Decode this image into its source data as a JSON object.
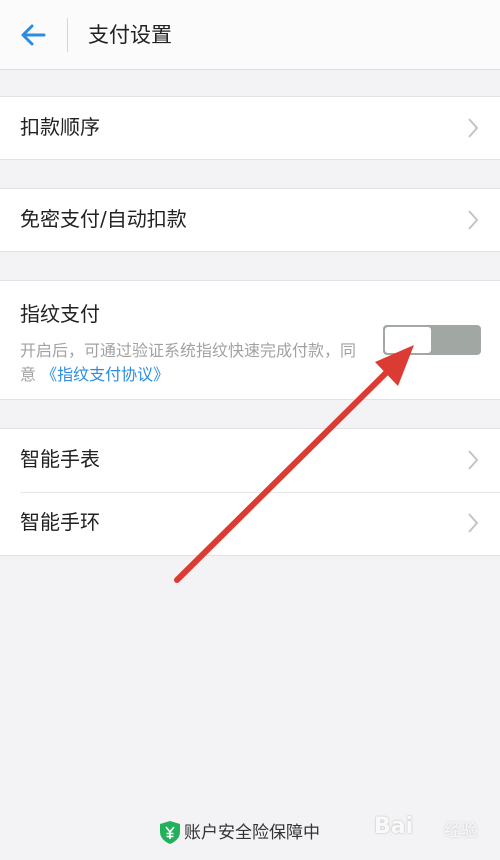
{
  "header": {
    "title": "支付设置",
    "back_icon": "arrow-left-icon"
  },
  "settings": {
    "deduction_order": "扣款顺序",
    "password_free": "免密支付/自动扣款",
    "fingerprint": {
      "title": "指纹支付",
      "description": "开启后，可通过验证系统指纹快速完成付款，同意",
      "agreement_link": "《指纹支付协议》",
      "toggle_on": false
    },
    "smart_watch": "智能手表",
    "smart_band": "智能手环"
  },
  "footer": {
    "security_text": "账户安全险保障中",
    "shield_icon": "shield-yuan-icon"
  },
  "watermark": {
    "text": "Bai",
    "sub": "经验"
  },
  "colors": {
    "accent": "#2c8de0",
    "annotation_arrow": "#dc3b33",
    "toggle_off": "#a1a8a3",
    "shield_green": "#21b15a"
  }
}
